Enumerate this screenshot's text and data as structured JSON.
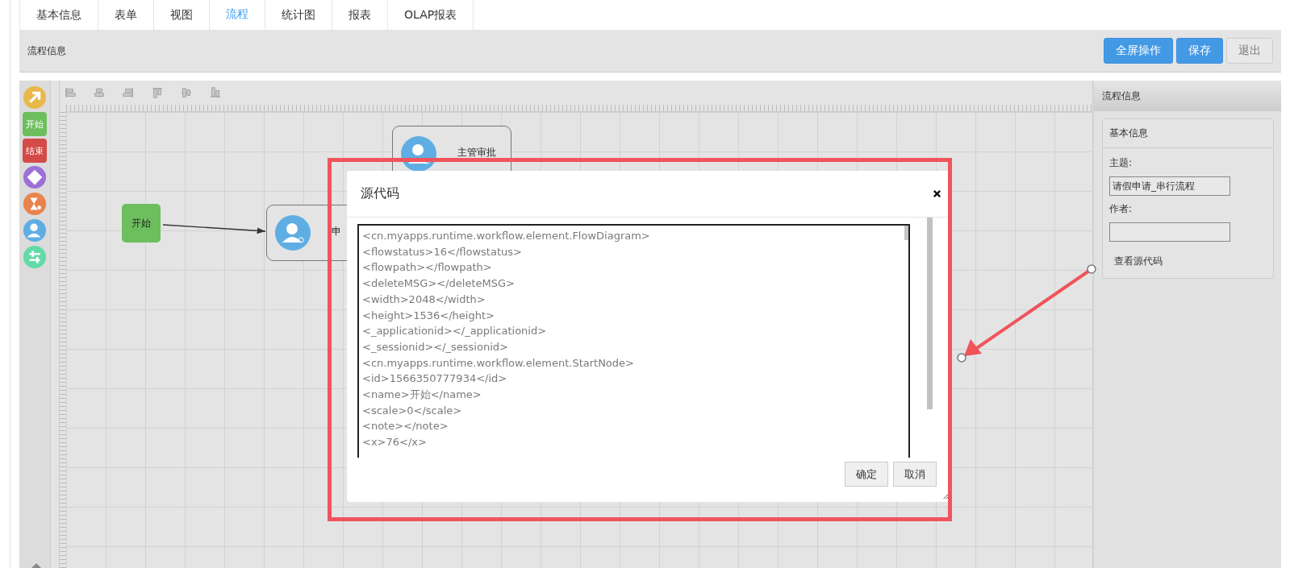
{
  "tabs": [
    {
      "label": "基本信息",
      "selected": false
    },
    {
      "label": "表单",
      "selected": false
    },
    {
      "label": "视图",
      "selected": false
    },
    {
      "label": "流程",
      "selected": true
    },
    {
      "label": "统计图",
      "selected": false
    },
    {
      "label": "报表",
      "selected": false
    },
    {
      "label": "OLAP报表",
      "selected": false
    }
  ],
  "header": {
    "title": "流程信息",
    "buttons": [
      {
        "label": "全屏操作",
        "kind": "primary"
      },
      {
        "label": "保存",
        "kind": "primary"
      },
      {
        "label": "退出",
        "kind": "default"
      }
    ]
  },
  "palette": [
    {
      "kind": "pointer"
    },
    {
      "kind": "start",
      "label": "开始"
    },
    {
      "kind": "end",
      "label": "结束"
    },
    {
      "kind": "gateway"
    },
    {
      "kind": "timer"
    },
    {
      "kind": "task"
    },
    {
      "kind": "subflow"
    }
  ],
  "canvas": {
    "nodes": [
      {
        "kind": "start",
        "label": "开始"
      },
      {
        "kind": "task",
        "label": "申"
      },
      {
        "kind": "task",
        "label": "主管审批"
      }
    ]
  },
  "side_panel": {
    "title": "流程信息",
    "section": "基本信息",
    "fields": [
      {
        "label": "主题:",
        "value": "请假申请_串行流程"
      },
      {
        "label": "作者:"
      }
    ],
    "link": "查看源代码"
  },
  "dialog": {
    "title": "源代码",
    "code_lines": [
      "<cn.myapps.runtime.workflow.element.FlowDiagram>",
      "<flowstatus>16</flowstatus>",
      "<flowpath></flowpath>",
      "<deleteMSG></deleteMSG>",
      "<width>2048</width>",
      "<height>1536</height>",
      "<_applicationid></_applicationid>",
      "<_sessionid></_sessionid>",
      "<cn.myapps.runtime.workflow.element.StartNode>",
      "<id>1566350777934</id>",
      "<name>开始</name>",
      "<scale>0</scale>",
      "<note></note>",
      "<x>76</x>"
    ],
    "buttons": [
      "确定",
      "取消"
    ]
  }
}
